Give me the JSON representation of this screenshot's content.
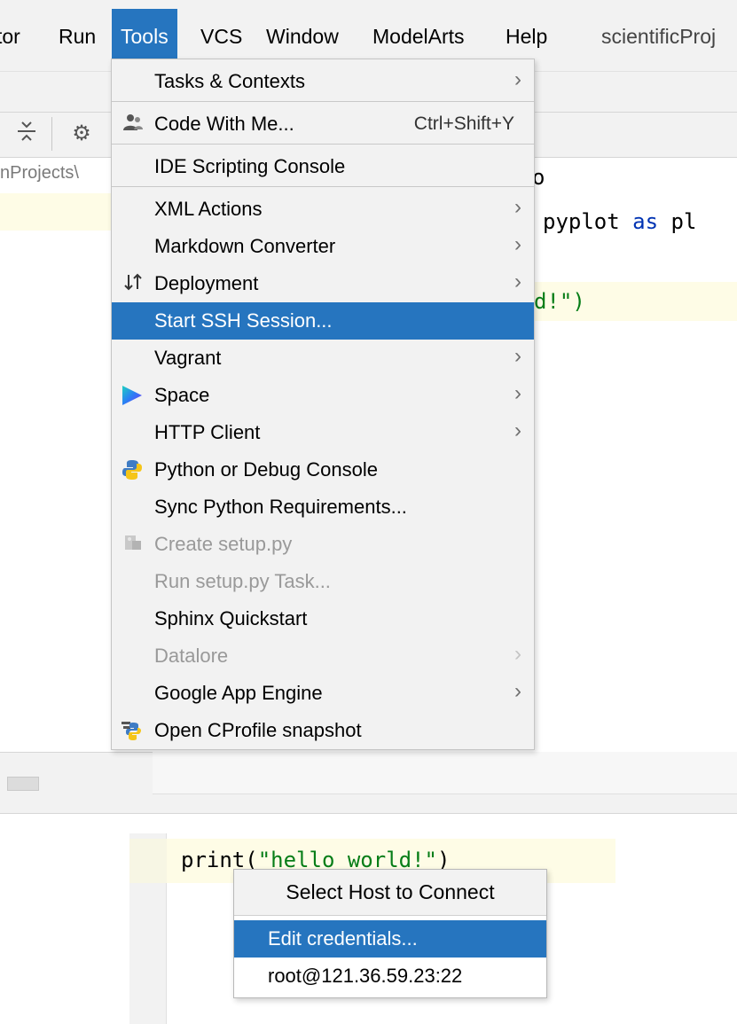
{
  "menubar": {
    "items": [
      "tor",
      "Run",
      "Tools",
      "VCS",
      "Window",
      "ModelArts",
      "Help"
    ],
    "title": "scientificProj"
  },
  "breadcrumb": {
    "text": "nProjects\\"
  },
  "editor": {
    "line1_tail": "o",
    "line2_module": "pyplot",
    "line2_as": "as",
    "line2_alias": "pl",
    "line3_tail": "d!\")"
  },
  "tools_menu": {
    "items": [
      {
        "label": "Tasks & Contexts",
        "submenu": true
      },
      {
        "label": "Code With Me...",
        "shortcut": "Ctrl+Shift+Y",
        "icon": "people-icon"
      },
      {
        "label": "IDE Scripting Console"
      },
      {
        "label": "XML Actions",
        "submenu": true
      },
      {
        "label": "Markdown Converter",
        "submenu": true
      },
      {
        "label": "Deployment",
        "submenu": true,
        "icon": "transfer-arrows-icon"
      },
      {
        "label": "Start SSH Session...",
        "selected": true
      },
      {
        "label": "Vagrant",
        "submenu": true
      },
      {
        "label": "Space",
        "submenu": true,
        "icon": "space-logo-icon"
      },
      {
        "label": "HTTP Client",
        "submenu": true
      },
      {
        "label": "Python or Debug Console",
        "icon": "python-icon"
      },
      {
        "label": "Sync Python Requirements..."
      },
      {
        "label": "Create setup.py",
        "disabled": true,
        "icon": "setup-py-icon"
      },
      {
        "label": "Run setup.py Task...",
        "disabled": true
      },
      {
        "label": "Sphinx Quickstart"
      },
      {
        "label": "Datalore",
        "submenu": true,
        "disabled": true
      },
      {
        "label": "Google App Engine",
        "submenu": true
      },
      {
        "label": "Open CProfile snapshot",
        "icon": "cprofile-icon"
      }
    ]
  },
  "editor2": {
    "fn": "print(",
    "arg": "\"hello world!\"",
    "close": ")"
  },
  "host_popup": {
    "title": "Select Host to Connect",
    "items": [
      {
        "label": "Edit credentials...",
        "selected": true
      },
      {
        "label": "root@121.36.59.23:22"
      }
    ]
  },
  "colors": {
    "selection": "#2675bf",
    "menu_bg": "#f2f2f2",
    "keyword": "#0033b3",
    "string": "#067d17",
    "disabled_text": "#999999"
  }
}
